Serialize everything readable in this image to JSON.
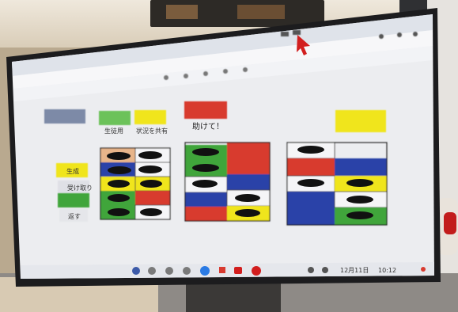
{
  "scene": {
    "description_text": "",
    "screen_label_red_box": "助けて！",
    "sheet_labels": [
      "生徒用",
      "状況を共有"
    ],
    "left_column_labels": [
      "生成",
      "受け取り",
      "返す"
    ],
    "taskbar": {
      "date": "12月11日",
      "time": "10:12"
    }
  },
  "colors": {
    "red": "#d83a2f",
    "yellow": "#f0e51a",
    "green": "#3fa53a",
    "blue": "#2b43a8",
    "peach": "#e8b58a",
    "grey": "#c9c9cd"
  }
}
